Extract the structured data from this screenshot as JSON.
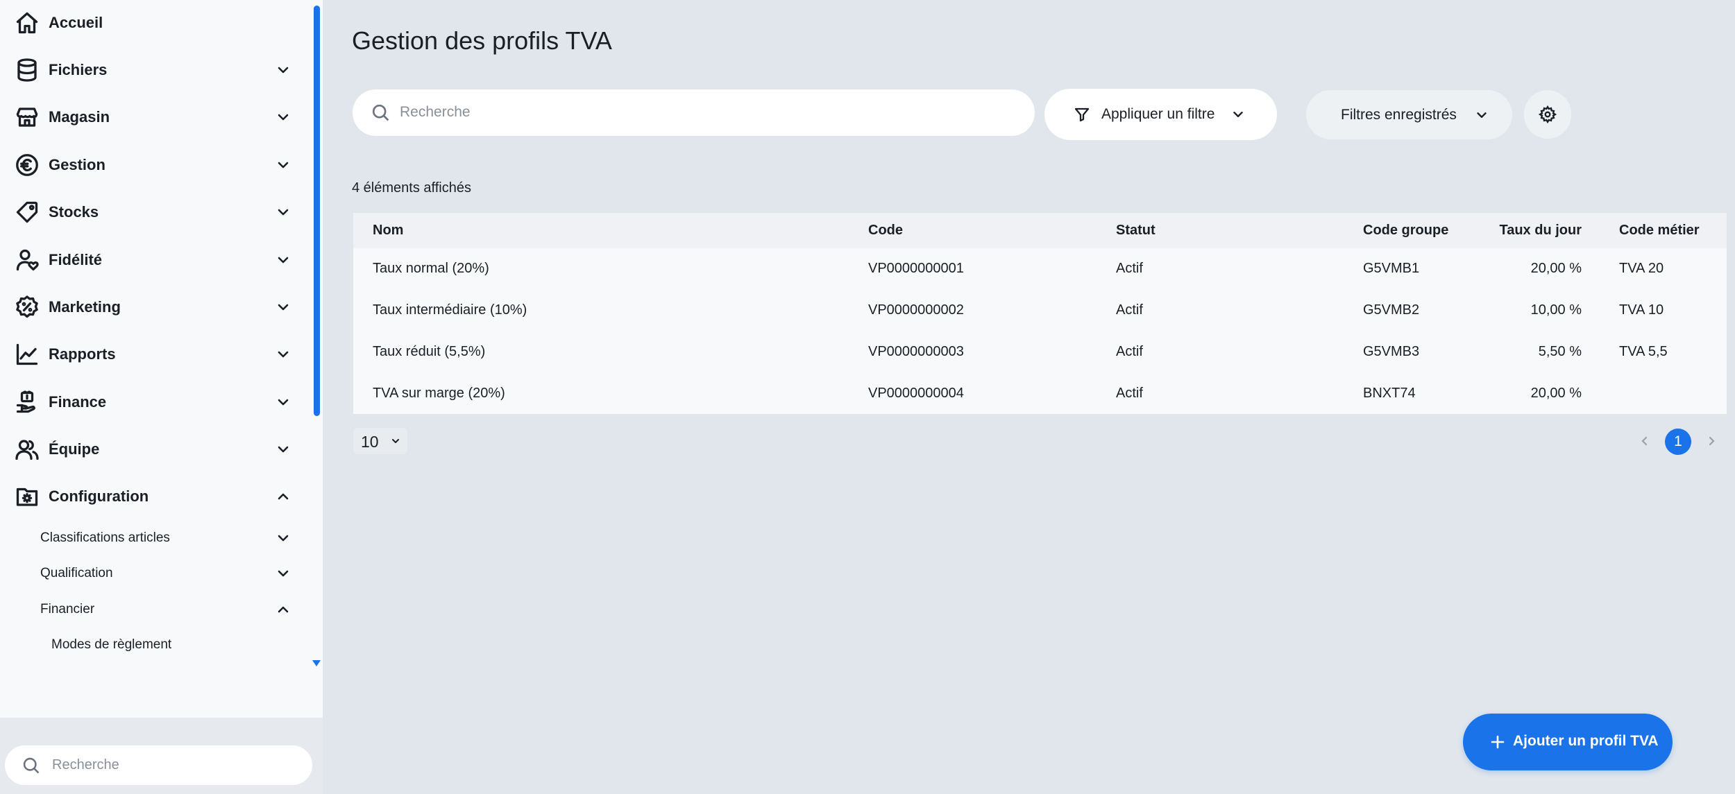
{
  "sidebar": {
    "nav": [
      {
        "label": "Accueil",
        "icon": "home-icon"
      },
      {
        "label": "Fichiers",
        "icon": "database-icon"
      },
      {
        "label": "Magasin",
        "icon": "store-icon"
      },
      {
        "label": "Gestion",
        "icon": "euro-icon"
      },
      {
        "label": "Stocks",
        "icon": "tag-icon"
      },
      {
        "label": "Fidélité",
        "icon": "user-heart-icon"
      },
      {
        "label": "Marketing",
        "icon": "discount-badge-icon"
      },
      {
        "label": "Rapports",
        "icon": "chart-line-icon"
      },
      {
        "label": "Finance",
        "icon": "money-hand-icon"
      },
      {
        "label": "Équipe",
        "icon": "team-icon"
      },
      {
        "label": "Configuration",
        "icon": "settings-folder-icon"
      }
    ],
    "sub": [
      {
        "label": "Classifications articles"
      },
      {
        "label": "Qualification"
      },
      {
        "label": "Financier"
      }
    ],
    "subsub": [
      {
        "label": "Modes de règlement"
      }
    ],
    "search": {
      "placeholder": "Recherche"
    }
  },
  "main": {
    "title": "Gestion des profils TVA",
    "search": {
      "placeholder": "Recherche"
    },
    "filter_label": "Appliquer un filtre",
    "saved_filters_label": "Filtres enregistrés",
    "count_text": "4 éléments affichés",
    "table": {
      "headers": {
        "nom": "Nom",
        "code": "Code",
        "statut": "Statut",
        "code_groupe": "Code groupe",
        "taux": "Taux du jour",
        "code_metier": "Code métier"
      },
      "rows": [
        {
          "nom": "Taux normal (20%)",
          "code": "VP0000000001",
          "statut": "Actif",
          "code_groupe": "G5VMB1",
          "taux": "20,00 %",
          "code_metier": "TVA 20"
        },
        {
          "nom": "Taux intermédiaire (10%)",
          "code": "VP0000000002",
          "statut": "Actif",
          "code_groupe": "G5VMB2",
          "taux": "10,00 %",
          "code_metier": "TVA 10"
        },
        {
          "nom": "Taux réduit (5,5%)",
          "code": "VP0000000003",
          "statut": "Actif",
          "code_groupe": "G5VMB3",
          "taux": "5,50 %",
          "code_metier": "TVA 5,5"
        },
        {
          "nom": "TVA sur marge (20%)",
          "code": "VP0000000004",
          "statut": "Actif",
          "code_groupe": "BNXT74",
          "taux": "20,00 %",
          "code_metier": ""
        }
      ]
    },
    "pagination": {
      "page_size": "10",
      "current_page": "1"
    },
    "add_button_label": "Ajouter un profil TVA"
  },
  "colors": {
    "accent": "#1a73e8",
    "background": "#e1e6ec",
    "sidebar": "#f8f9fb"
  }
}
